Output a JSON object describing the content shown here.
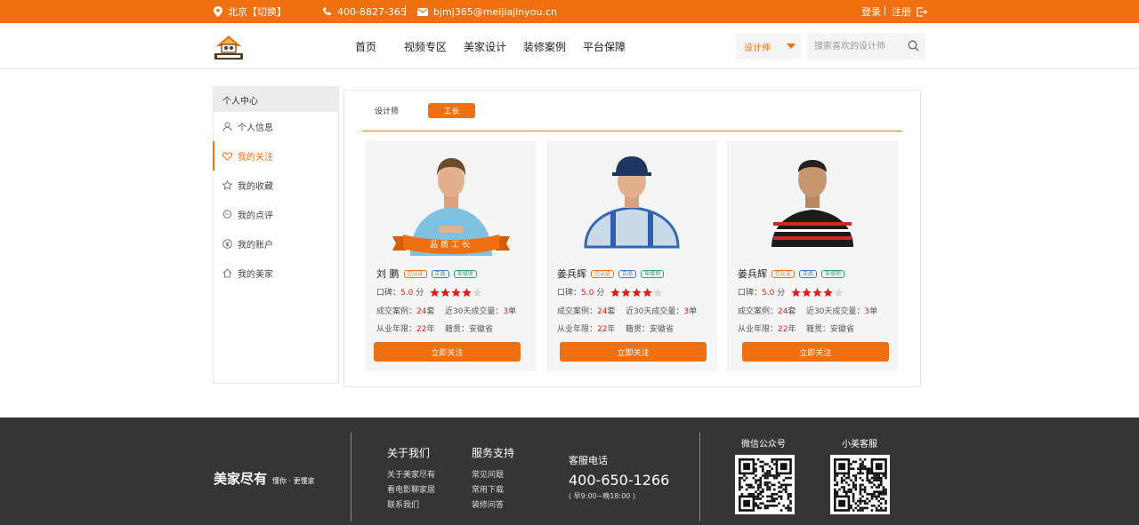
{
  "topbar": {
    "city": "北京【切换】",
    "phone": "400-8827-365",
    "email": "bjmj365@meijiajinyou.cn",
    "login": "登录",
    "register": "注册"
  },
  "header": {
    "nav": [
      "首页",
      "视频专区",
      "美家设计",
      "装修案例",
      "平台保障"
    ],
    "select_value": "设计师",
    "search_placeholder": "搜索喜欢的设计师"
  },
  "sidebar": {
    "title": "个人中心",
    "items": [
      {
        "label": "个人信息",
        "icon": "user-icon"
      },
      {
        "label": "我的关注",
        "icon": "heart-icon"
      },
      {
        "label": "我的收藏",
        "icon": "star-icon"
      },
      {
        "label": "我的点评",
        "icon": "comment-icon"
      },
      {
        "label": "我的账户",
        "icon": "yen-icon"
      },
      {
        "label": "我的美家",
        "icon": "home-icon"
      }
    ]
  },
  "tabs": [
    "设计师",
    "工长"
  ],
  "ribbon_text": "品质工长",
  "cards": [
    {
      "name": "刘 鹏",
      "badges": [
        "已认证",
        "正品",
        "零增项"
      ],
      "rating_label": "口碑：",
      "rating": "5.0",
      "rating_unit": "分",
      "stars": 4,
      "cases_label": "成交案例：",
      "cases": "24",
      "cases_unit": "套",
      "deals_label": "近30天成交量：",
      "deals": "3",
      "deals_unit": "单",
      "years_label": "从业年限：",
      "years": "22",
      "years_unit": "年",
      "origin_label": "籍贯：",
      "origin": "安徽省",
      "button": "立即关注"
    },
    {
      "name": "姜兵辉",
      "badges": [
        "已认证",
        "正品",
        "零增项"
      ],
      "rating_label": "口碑：",
      "rating": "5.0",
      "rating_unit": "分",
      "stars": 4,
      "cases_label": "成交案例：",
      "cases": "24",
      "cases_unit": "套",
      "deals_label": "近30天成交量：",
      "deals": "3",
      "deals_unit": "单",
      "years_label": "从业年限：",
      "years": "22",
      "years_unit": "年",
      "origin_label": "籍贯：",
      "origin": "安徽省",
      "button": "立即关注"
    },
    {
      "name": "姜兵辉",
      "badges": [
        "已认证",
        "正品",
        "零增项"
      ],
      "rating_label": "口碑：",
      "rating": "5.0",
      "rating_unit": "分",
      "stars": 4,
      "cases_label": "成交案例：",
      "cases": "24",
      "cases_unit": "套",
      "deals_label": "近30天成交量：",
      "deals": "3",
      "deals_unit": "单",
      "years_label": "从业年限：",
      "years": "22",
      "years_unit": "年",
      "origin_label": "籍贯：",
      "origin": "安徽省",
      "button": "立即关注"
    }
  ],
  "footer": {
    "brand": "美家尽有",
    "slogan": "懂你 · 更懂家",
    "about_title": "关于我们",
    "about_links": [
      "关于美家尽有",
      "看电影聊家居",
      "联系我们"
    ],
    "service_title": "服务支持",
    "service_links": [
      "常见问题",
      "常用下载",
      "装修问答"
    ],
    "hotline_label": "客服电话",
    "hotline": "400-650-1266",
    "hours": "( 早9:00~晚18:00 )",
    "wechat_label": "微信公众号",
    "service_qr_label": "小美客服"
  },
  "colors": {
    "accent": "#ee7011",
    "footer_bg": "#353535",
    "price_red": "#e01d1d"
  }
}
